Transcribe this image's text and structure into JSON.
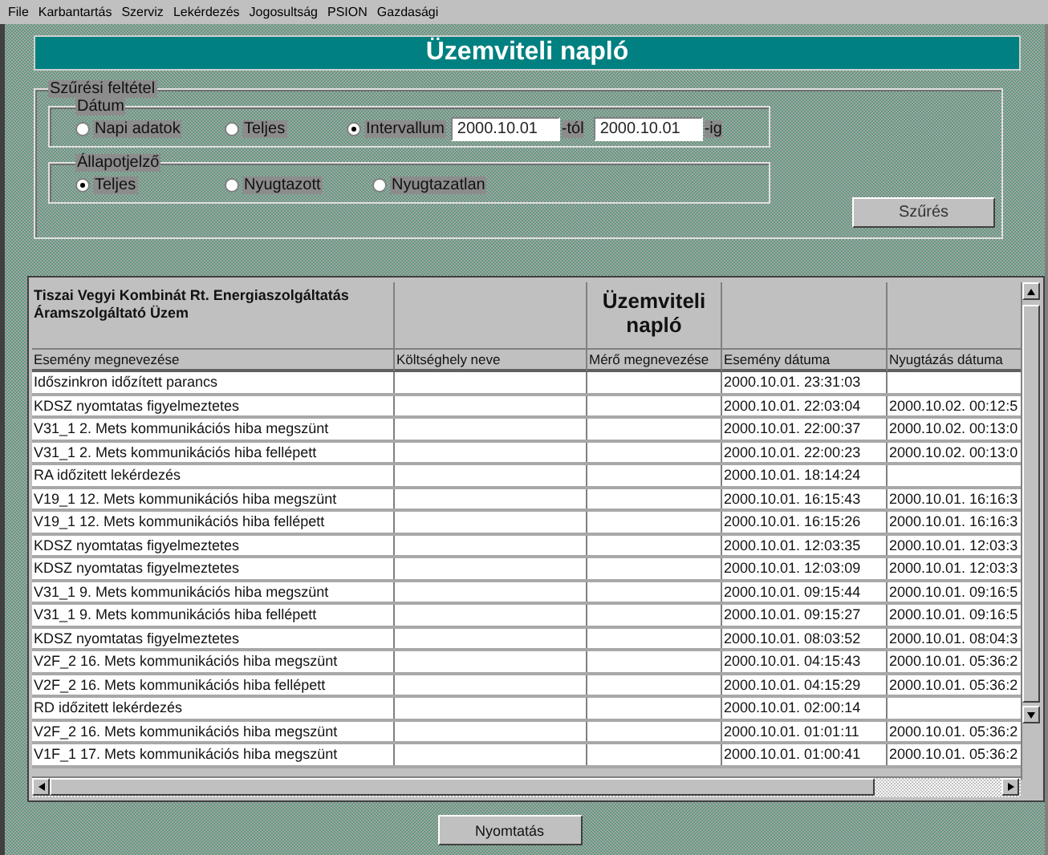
{
  "menu": [
    {
      "label": "File"
    },
    {
      "label": "Karbantartás"
    },
    {
      "label": "Szerviz"
    },
    {
      "label": "Lekérdezés"
    },
    {
      "label": "Jogosultság"
    },
    {
      "label": "PSION"
    },
    {
      "label": "Gazdasági"
    }
  ],
  "title": "Üzemviteli napló",
  "filter": {
    "legend": "Szűrési feltétel",
    "date_group": {
      "legend": "Dátum",
      "options": [
        {
          "label": "Napi adatok",
          "selected": false
        },
        {
          "label": "Teljes",
          "selected": false
        },
        {
          "label": "Intervallum",
          "selected": true
        }
      ],
      "from": {
        "value": "2000.10.01",
        "suffix": "-tól"
      },
      "to": {
        "value": "2000.10.01",
        "suffix": "-ig"
      }
    },
    "status_group": {
      "legend": "Állapotjelző",
      "options": [
        {
          "label": "Teljes",
          "selected": true
        },
        {
          "label": "Nyugtazott",
          "selected": false
        },
        {
          "label": "Nyugtazatlan",
          "selected": false
        }
      ]
    },
    "button": "Szűrés"
  },
  "report": {
    "company": [
      "Tiszai Vegyi Kombinát Rt. Energiaszolgáltatás",
      "Áramszolgáltató Üzem"
    ],
    "title": "Üzemviteli napló",
    "columns": [
      "Esemény megnevezése",
      "Költséghely neve",
      "Mérő megnevezése",
      "Esemény dátuma",
      "Nyugtázás dátuma"
    ],
    "rows": [
      {
        "event": "Időszinkron időzített parancs",
        "event_date": "2000.10.01. 23:31:03"
      },
      {
        "event": "KDSZ nyomtatas figyelmeztetes",
        "event_date": "2000.10.01. 22:03:04",
        "ack_date": "2000.10.02. 00:12:5"
      },
      {
        "event": "V31_1 2. Mets kommunikációs hiba megszünt",
        "event_date": "2000.10.01. 22:00:37",
        "ack_date": "2000.10.02. 00:13:0"
      },
      {
        "event": "V31_1 2. Mets kommunikációs hiba fellépett",
        "event_date": "2000.10.01. 22:00:23",
        "ack_date": "2000.10.02. 00:13:0"
      },
      {
        "event": "RA időzitett lekérdezés",
        "event_date": "2000.10.01. 18:14:24"
      },
      {
        "event": "V19_1 12. Mets kommunikációs hiba megszünt",
        "event_date": "2000.10.01. 16:15:43",
        "ack_date": "2000.10.01. 16:16:3"
      },
      {
        "event": "V19_1 12. Mets kommunikációs hiba fellépett",
        "event_date": "2000.10.01. 16:15:26",
        "ack_date": "2000.10.01. 16:16:3"
      },
      {
        "event": "KDSZ nyomtatas figyelmeztetes",
        "event_date": "2000.10.01. 12:03:35",
        "ack_date": "2000.10.01. 12:03:3"
      },
      {
        "event": "KDSZ nyomtatas figyelmeztetes",
        "event_date": "2000.10.01. 12:03:09",
        "ack_date": "2000.10.01. 12:03:3"
      },
      {
        "event": "V31_1 9. Mets kommunikációs hiba megszünt",
        "event_date": "2000.10.01. 09:15:44",
        "ack_date": "2000.10.01. 09:16:5"
      },
      {
        "event": "V31_1 9. Mets kommunikációs hiba fellépett",
        "event_date": "2000.10.01. 09:15:27",
        "ack_date": "2000.10.01. 09:16:5"
      },
      {
        "event": "KDSZ nyomtatas figyelmeztetes",
        "event_date": "2000.10.01. 08:03:52",
        "ack_date": "2000.10.01. 08:04:3"
      },
      {
        "event": "V2F_2 16. Mets kommunikációs hiba megszünt",
        "event_date": "2000.10.01. 04:15:43",
        "ack_date": "2000.10.01. 05:36:2"
      },
      {
        "event": "V2F_2 16. Mets kommunikációs hiba fellépett",
        "event_date": "2000.10.01. 04:15:29",
        "ack_date": "2000.10.01. 05:36:2"
      },
      {
        "event": "RD időzitett lekérdezés",
        "event_date": "2000.10.01. 02:00:14"
      },
      {
        "event": "V2F_2 16. Mets kommunikációs hiba megszünt",
        "event_date": "2000.10.01. 01:01:11",
        "ack_date": "2000.10.01. 05:36:2"
      },
      {
        "event": "V1F_1 17. Mets kommunikációs hiba megszünt",
        "event_date": "2000.10.01. 01:00:41",
        "ack_date": "2000.10.01. 05:36:2"
      }
    ]
  },
  "print_button": "Nyomtatás"
}
